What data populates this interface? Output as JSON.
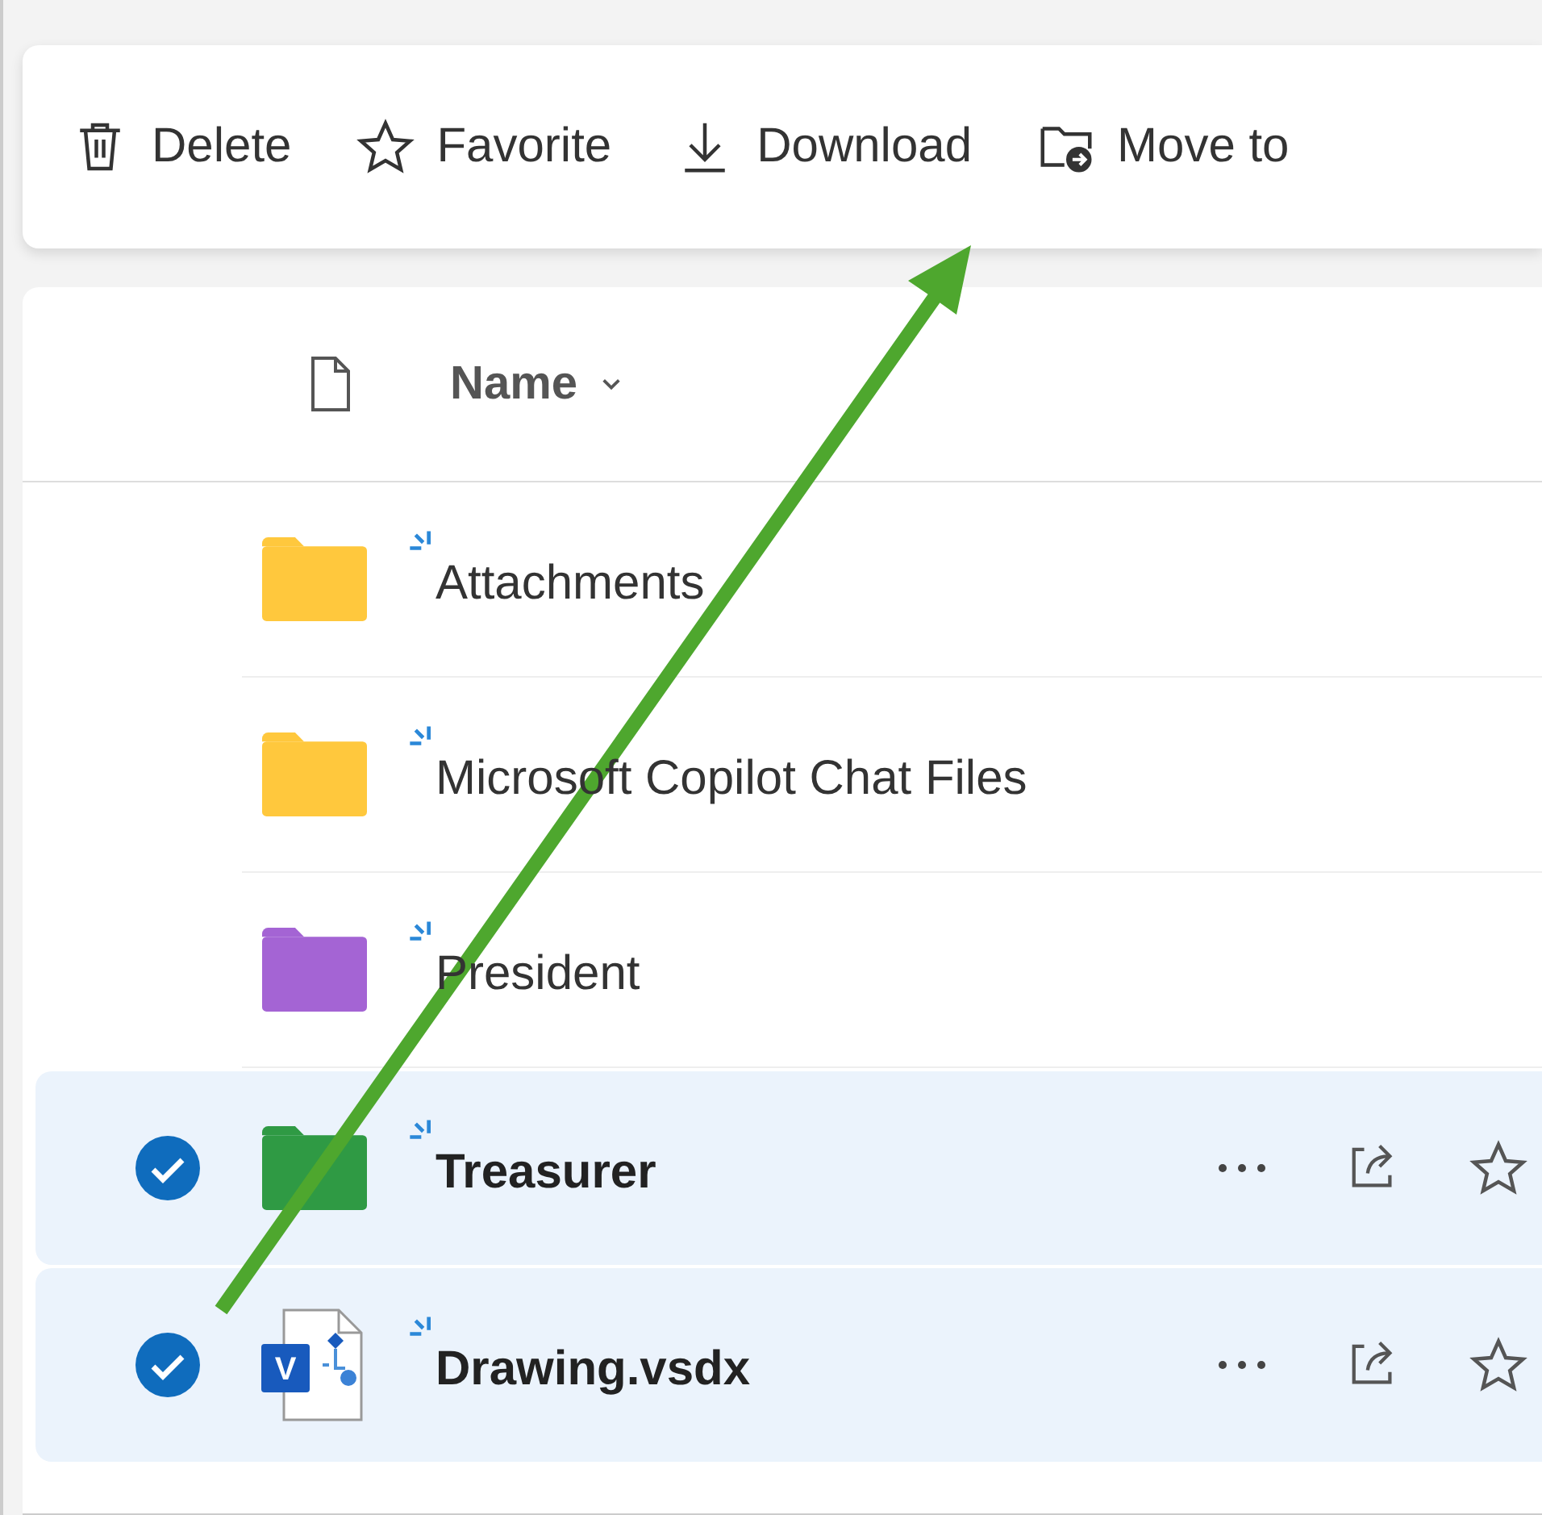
{
  "toolbar": [
    {
      "label": "Delete",
      "kind": "delete"
    },
    {
      "label": "Favorite",
      "kind": "favorite"
    },
    {
      "label": "Download",
      "kind": "download"
    },
    {
      "label": "Move to",
      "kind": "move"
    }
  ],
  "header": {
    "label": "Name"
  },
  "rows": [
    {
      "name": "Attachments",
      "kind": "folder",
      "color": "#ffc83d",
      "selected": false
    },
    {
      "name": "Microsoft Copilot Chat Files",
      "kind": "folder",
      "color": "#ffc83d",
      "selected": false
    },
    {
      "name": "President",
      "kind": "folder",
      "color": "#a464d4",
      "selected": false
    },
    {
      "name": "Treasurer",
      "kind": "folder",
      "color": "#2f9a44",
      "selected": true
    },
    {
      "name": "Drawing.vsdx",
      "kind": "visio",
      "icon_letter": "V",
      "selected": true
    }
  ]
}
